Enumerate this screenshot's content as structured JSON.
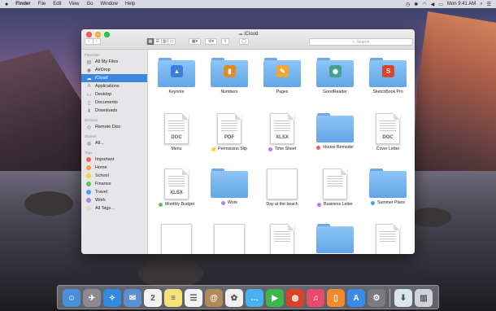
{
  "menubar": {
    "app": "Finder",
    "items": [
      "File",
      "Edit",
      "View",
      "Go",
      "Window",
      "Help"
    ],
    "clock": "Mon 9:41 AM"
  },
  "window": {
    "title": "iCloud",
    "search_placeholder": "Search"
  },
  "sidebar": {
    "sections": [
      {
        "header": "Favorites",
        "items": [
          {
            "label": "All My Files",
            "icon": "all-files-icon",
            "glyph": "▤"
          },
          {
            "label": "AirDrop",
            "icon": "airdrop-icon",
            "glyph": "◉"
          },
          {
            "label": "iCloud",
            "icon": "cloud-icon",
            "glyph": "☁",
            "selected": true
          },
          {
            "label": "Applications",
            "icon": "applications-icon",
            "glyph": "A"
          },
          {
            "label": "Desktop",
            "icon": "desktop-icon",
            "glyph": "▭"
          },
          {
            "label": "Documents",
            "icon": "documents-icon",
            "glyph": "▯"
          },
          {
            "label": "Downloads",
            "icon": "downloads-icon",
            "glyph": "⬇"
          }
        ]
      },
      {
        "header": "Devices",
        "items": [
          {
            "label": "Remote Disc",
            "icon": "disc-icon",
            "glyph": "◎"
          }
        ]
      },
      {
        "header": "Shared",
        "items": [
          {
            "label": "All...",
            "icon": "network-icon",
            "glyph": "◍"
          }
        ]
      },
      {
        "header": "Tags",
        "items": [
          {
            "label": "Important",
            "tag": "#f0605a"
          },
          {
            "label": "Home",
            "tag": "#f4a23b"
          },
          {
            "label": "School",
            "tag": "#f4d23b"
          },
          {
            "label": "Finance",
            "tag": "#5fc05a"
          },
          {
            "label": "Travel",
            "tag": "#4a9ef0"
          },
          {
            "label": "Work",
            "tag": "#b57ee0"
          },
          {
            "label": "All Tags...",
            "tag": "#d8d8d8"
          }
        ]
      }
    ]
  },
  "files": [
    {
      "name": "Keynote",
      "kind": "folder",
      "emblem": "#3d7fd8",
      "glyph": "▲"
    },
    {
      "name": "Numbers",
      "kind": "folder",
      "emblem": "#e08a2a",
      "glyph": "▮"
    },
    {
      "name": "Pages",
      "kind": "folder",
      "emblem": "#f0a830",
      "glyph": "✎"
    },
    {
      "name": "GoodReader",
      "kind": "folder",
      "emblem": "#4a9e8e",
      "glyph": "◉"
    },
    {
      "name": "SketchBook Pro",
      "kind": "folder",
      "emblem": "#d8442a",
      "glyph": "S"
    },
    {
      "name": "Menu",
      "kind": "doc",
      "badge": "DOC"
    },
    {
      "name": "Permission Slip",
      "kind": "doc",
      "badge": "PDF",
      "tag": "#f4d23b"
    },
    {
      "name": "Time Sheet",
      "kind": "doc",
      "badge": "XLSX",
      "tag": "#b57ee0"
    },
    {
      "name": "House Remodel",
      "kind": "folder",
      "tag": "#f0605a"
    },
    {
      "name": "Cover Letter",
      "kind": "doc",
      "badge": "DOC"
    },
    {
      "name": "Monthly Budget",
      "kind": "doc",
      "badge": "XLSX",
      "tag": "#5fc05a"
    },
    {
      "name": "Work",
      "kind": "folder",
      "tag": "#b57ee0"
    },
    {
      "name": "Day at the beach",
      "kind": "blank"
    },
    {
      "name": "Business Letter",
      "kind": "doc",
      "badge": "",
      "tag": "#b57ee0"
    },
    {
      "name": "Summer Plans",
      "kind": "folder",
      "tag": "#4a9ef0"
    },
    {
      "name": "",
      "kind": "blank"
    },
    {
      "name": "",
      "kind": "blank"
    },
    {
      "name": "",
      "kind": "doc",
      "badge": ""
    },
    {
      "name": "",
      "kind": "folder"
    },
    {
      "name": "",
      "kind": "doc",
      "badge": ""
    }
  ],
  "dock": [
    {
      "name": "finder-icon",
      "color": "#4a90d9",
      "glyph": "☺"
    },
    {
      "name": "launchpad-icon",
      "color": "#8a8a90",
      "glyph": "✈"
    },
    {
      "name": "safari-icon",
      "color": "#2f8ae0",
      "glyph": "✧"
    },
    {
      "name": "mail-icon",
      "color": "#5a8fd0",
      "glyph": "✉"
    },
    {
      "name": "calendar-icon",
      "color": "#f2f2f2",
      "glyph": "2"
    },
    {
      "name": "notes-icon",
      "color": "#f6e27a",
      "glyph": "≡"
    },
    {
      "name": "reminders-icon",
      "color": "#f4f4f4",
      "glyph": "☰"
    },
    {
      "name": "contacts-icon",
      "color": "#b08a5a",
      "glyph": "@"
    },
    {
      "name": "photos-icon",
      "color": "#f0f0f0",
      "glyph": "✿"
    },
    {
      "name": "messages-icon",
      "color": "#4ab0f0",
      "glyph": "…"
    },
    {
      "name": "facetime-icon",
      "color": "#3cb84a",
      "glyph": "▶"
    },
    {
      "name": "photo-booth-icon",
      "color": "#d8442a",
      "glyph": "◍"
    },
    {
      "name": "itunes-icon",
      "color": "#ea4a6a",
      "glyph": "♫"
    },
    {
      "name": "ibooks-icon",
      "color": "#f08a2a",
      "glyph": "▯"
    },
    {
      "name": "app-store-icon",
      "color": "#3a8ae8",
      "glyph": "A"
    },
    {
      "name": "system-preferences-icon",
      "color": "#7a7a80",
      "glyph": "⚙"
    },
    {
      "name": "downloads-stack-icon",
      "color": "#d8e4f0",
      "glyph": "⬇"
    },
    {
      "name": "trash-icon",
      "color": "#cfd4da",
      "glyph": "▥"
    }
  ]
}
